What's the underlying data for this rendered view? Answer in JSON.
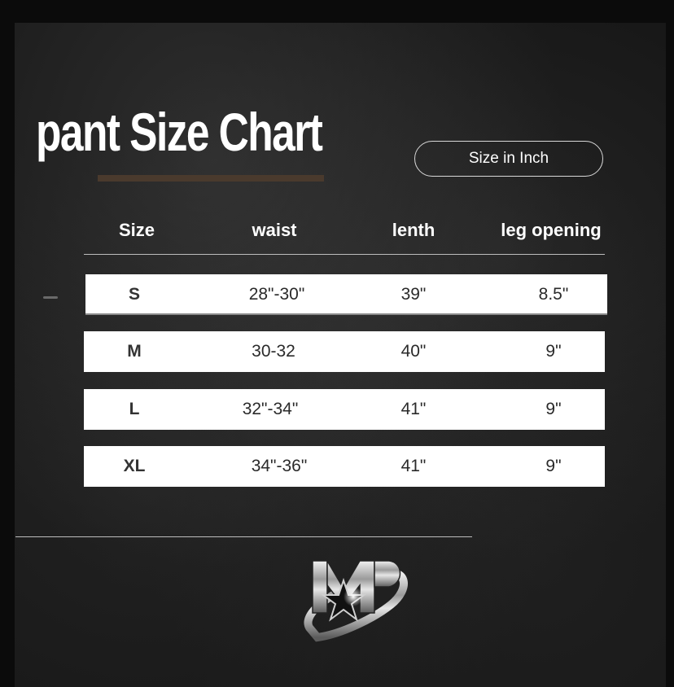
{
  "title": "pant Size Chart",
  "unit_label": "Size in Inch",
  "columns": [
    "Size",
    "waist",
    "lenth",
    "leg opening"
  ],
  "rows": [
    {
      "size": "S",
      "waist": "28\"-30\"",
      "length": "39\"",
      "leg_opening": "8.5\""
    },
    {
      "size": "M",
      "waist": "30-32",
      "length": "40\"",
      "leg_opening": "9\""
    },
    {
      "size": "L",
      "waist": "32\"-34\"",
      "length": "41\"",
      "leg_opening": "9\""
    },
    {
      "size": "XL",
      "waist": "34\"-36\"",
      "length": "41\"",
      "leg_opening": "9\""
    }
  ],
  "logo": {
    "icon": "star-brand-logo-icon"
  },
  "colors": {
    "background": "#161616",
    "title_text": "#ffffff",
    "underline_accent": "#4a3a2d",
    "row_background": "#ffffff",
    "row_text": "#2a2a2a"
  }
}
